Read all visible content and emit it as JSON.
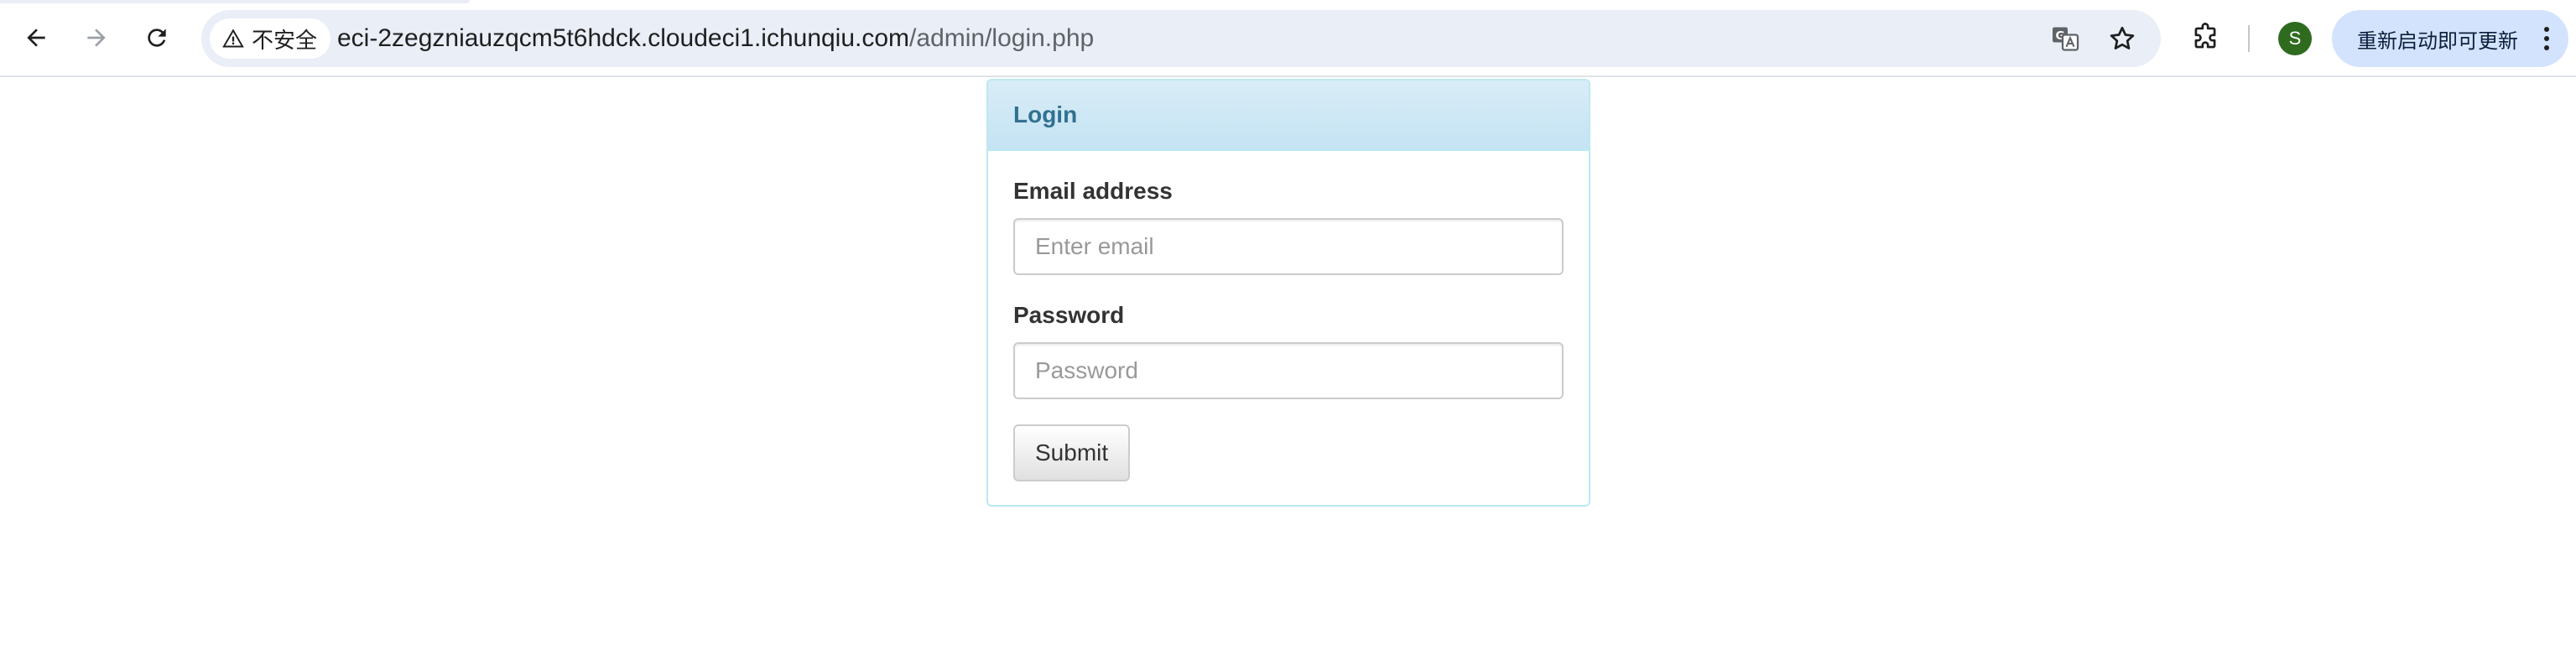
{
  "browser": {
    "security_label": "不安全",
    "url_host": "eci-2zegzniauzqcm5t6hdck.cloudeci1.ichunqiu.com",
    "url_path": "/admin/login.php",
    "profile_initial": "S",
    "update_label": "重新启动即可更新",
    "accent_color": "#d3e3fd",
    "avatar_color": "#2e6b1f"
  },
  "login": {
    "title": "Login",
    "email_label": "Email address",
    "email_placeholder": "Enter email",
    "email_value": "",
    "password_label": "Password",
    "password_placeholder": "Password",
    "password_value": "",
    "submit_label": "Submit",
    "heading_color": "#31708f",
    "border_color": "#bce8f1"
  }
}
